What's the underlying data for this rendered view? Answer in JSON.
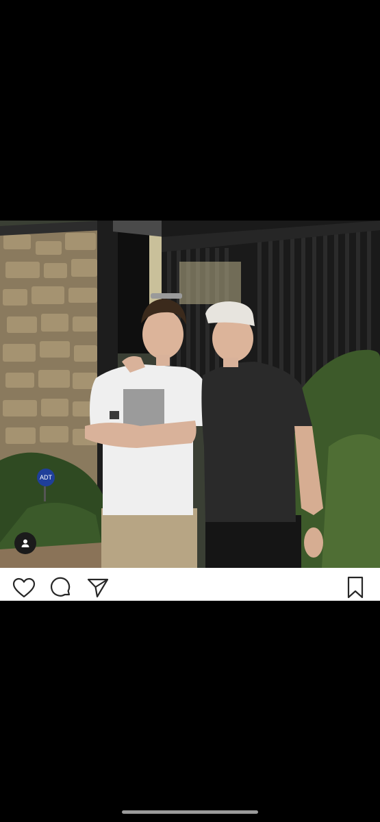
{
  "post": {
    "photo_description_icon": "photo",
    "sign_text": "ADT"
  },
  "actions": {
    "like_icon": "heart-icon",
    "comment_icon": "comment-icon",
    "share_icon": "send-icon",
    "save_icon": "bookmark-icon",
    "tag_icon": "user-tag-icon"
  },
  "colors": {
    "background": "#000000",
    "action_bar": "#ffffff",
    "icon": "#262626"
  }
}
